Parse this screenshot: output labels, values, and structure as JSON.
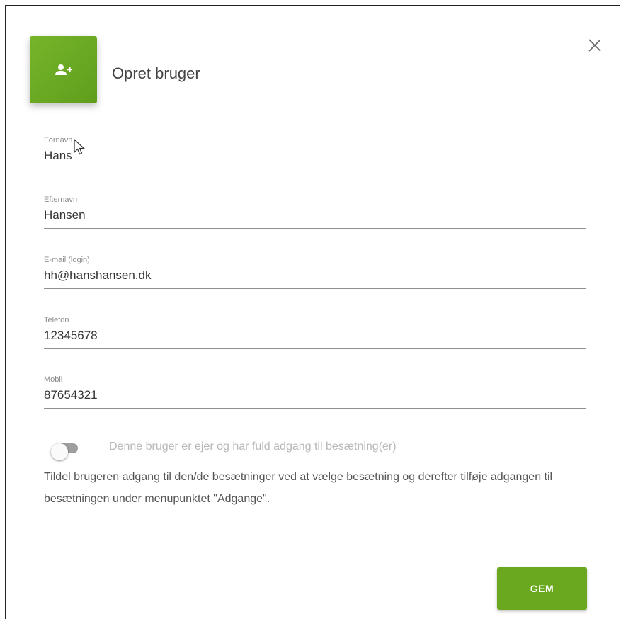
{
  "dialog": {
    "title": "Opret bruger",
    "header_icon": "add-user-icon",
    "close_icon": "close-icon",
    "accent_color": "#6aa81f"
  },
  "form": {
    "fields": [
      {
        "label": "Fornavn",
        "value": "Hans"
      },
      {
        "label": "Efternavn",
        "value": "Hansen"
      },
      {
        "label": "E-mail (login)",
        "value": "hh@hanshansen.dk"
      },
      {
        "label": "Telefon",
        "value": "12345678"
      },
      {
        "label": "Mobil",
        "value": "87654321"
      }
    ],
    "owner_toggle": {
      "label": "Denne bruger er ejer og har fuld adgang til besætning(er)",
      "checked": false
    },
    "info_text": "Tildel brugeren adgang til den/de besætninger ved at vælge besætning og derefter tilføje adgangen til besætningen under menupunktet \"Adgange\"."
  },
  "actions": {
    "save_label": "GEM"
  }
}
